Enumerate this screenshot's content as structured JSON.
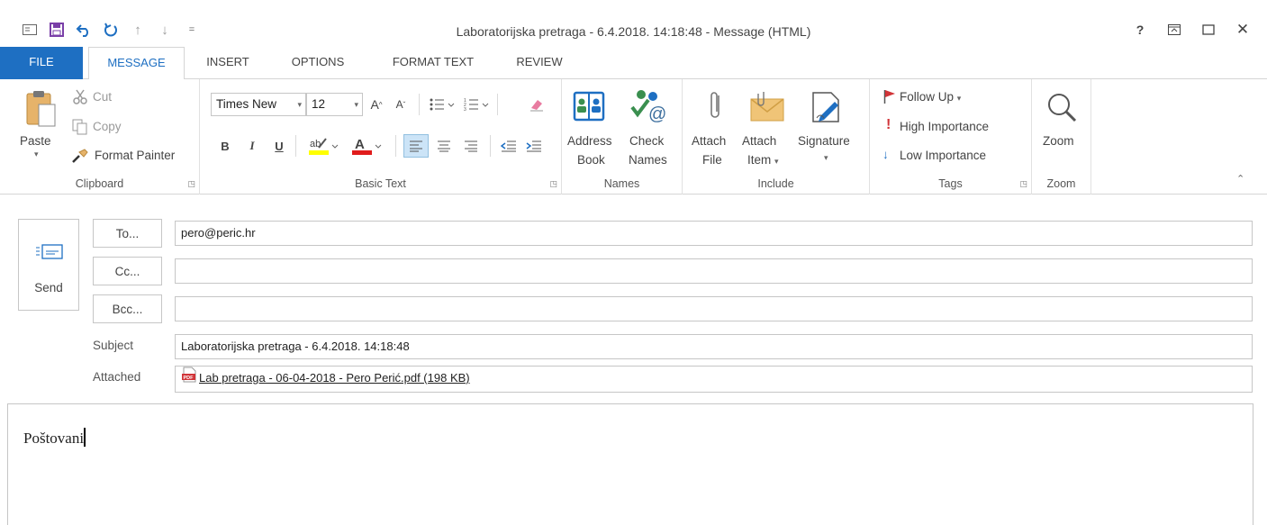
{
  "window": {
    "title": "Laboratorijska pretraga - 6.4.2018. 14:18:48 - Message (HTML)",
    "help": "?",
    "restore": "⧈",
    "maximize": "☐",
    "close": "✕"
  },
  "qat": {
    "save": "▣",
    "undo": "↶",
    "redo": "↻",
    "up": "↑",
    "down": "↓",
    "customize": "▾"
  },
  "tabs": [
    "FILE",
    "MESSAGE",
    "INSERT",
    "OPTIONS",
    "FORMAT TEXT",
    "REVIEW"
  ],
  "ribbon": {
    "clipboard": {
      "paste": "Paste",
      "cut": "Cut",
      "copy": "Copy",
      "format_painter": "Format Painter",
      "label": "Clipboard"
    },
    "basic_text": {
      "font": "Times New",
      "size": "12",
      "bold": "B",
      "italic": "I",
      "underline": "U",
      "grow": "A",
      "shrink": "A",
      "label": "Basic Text"
    },
    "names": {
      "address_book_1": "Address",
      "address_book_2": "Book",
      "check_names_1": "Check",
      "check_names_2": "Names",
      "label": "Names"
    },
    "include": {
      "attach_file_1": "Attach",
      "attach_file_2": "File",
      "attach_item_1": "Attach",
      "attach_item_2": "Item",
      "signature": "Signature",
      "label": "Include"
    },
    "tags": {
      "follow_up": "Follow Up",
      "high": "High Importance",
      "low": "Low Importance",
      "label": "Tags"
    },
    "zoom": {
      "zoom": "Zoom",
      "label": "Zoom"
    }
  },
  "compose": {
    "send": "Send",
    "to_button": "To...",
    "cc_button": "Cc...",
    "bcc_button": "Bcc...",
    "to_value": "pero@peric.hr",
    "cc_value": "",
    "bcc_value": "",
    "subject_label": "Subject",
    "subject_value": "Laboratorijska pretraga - 6.4.2018. 14:18:48",
    "attached_label": "Attached",
    "attachment_name": "Lab pretraga - 06-04-2018 - Pero Perić.pdf (198 KB)",
    "body_text": "Poštovani"
  },
  "colors": {
    "accent": "#1e6fc2",
    "highlight": "#ffff00",
    "font_color": "#e01c1c",
    "flag": "#d13438"
  }
}
